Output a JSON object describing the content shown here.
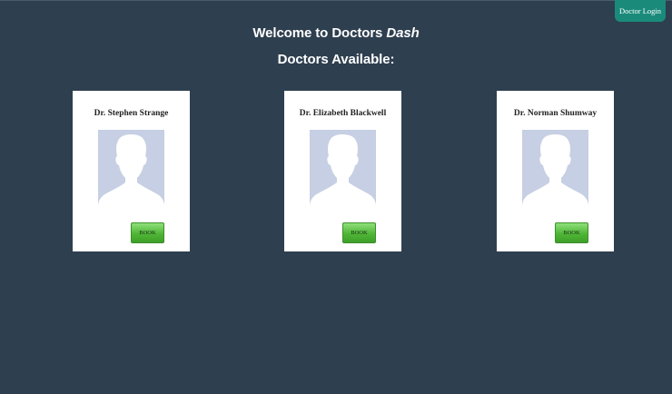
{
  "header": {
    "login_label": "Doctor Login"
  },
  "welcome": {
    "prefix": "Welcome to Doctors ",
    "brand": "Dash"
  },
  "section_title": "Doctors Available:",
  "doctors": [
    {
      "name": "Dr. Stephen Strange",
      "book_label": "BOOK"
    },
    {
      "name": "Dr. Elizabeth Blackwell",
      "book_label": "BOOK"
    },
    {
      "name": "Dr. Norman Shumway",
      "book_label": "BOOK"
    }
  ],
  "colors": {
    "background": "#2e3f4f",
    "login_button": "#1a8b7b",
    "book_button": "#4fb636",
    "avatar_placeholder": "#c6cfe3"
  }
}
